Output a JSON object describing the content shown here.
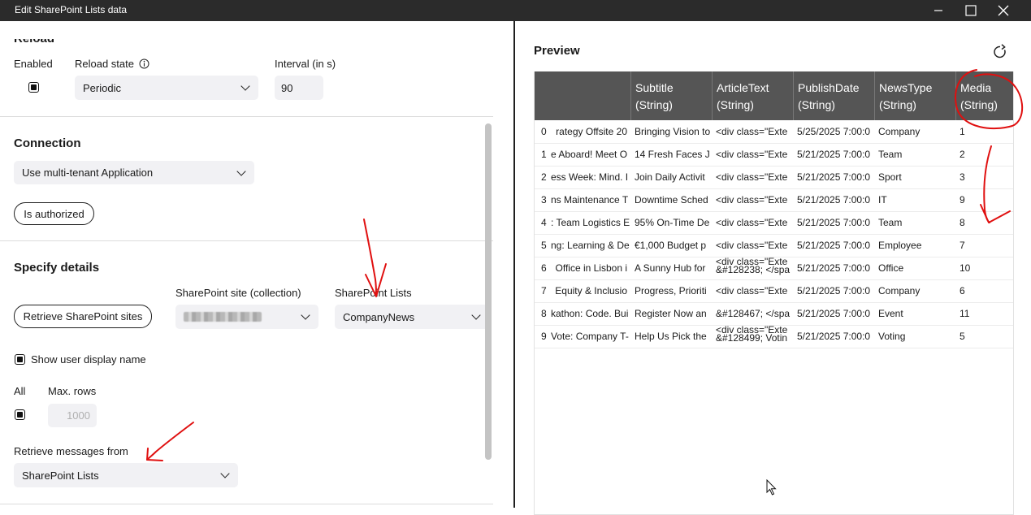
{
  "window": {
    "title": "Edit SharePoint Lists data",
    "minimize_icon": "minimize-icon",
    "maximize_icon": "maximize-icon",
    "close_icon": "close-icon"
  },
  "reload": {
    "section_title": "Reload",
    "enabled_label": "Enabled",
    "enabled_checked": true,
    "state_label": "Reload state",
    "state_info_icon": "info-icon",
    "state_value": "Periodic",
    "interval_label": "Interval (in s)",
    "interval_value": "90"
  },
  "connection": {
    "section_title": "Connection",
    "mode_value": "Use multi-tenant Application",
    "auth_button": "Is authorized"
  },
  "details": {
    "section_title": "Specify details",
    "retrieve_sites_button": "Retrieve SharePoint sites",
    "site_label": "SharePoint site (collection)",
    "site_value": "",
    "lists_label": "SharePoint Lists",
    "lists_value": "CompanyNews",
    "show_user_label": "Show user display name",
    "show_user_checked": true,
    "all_label": "All",
    "all_checked": true,
    "maxrows_label": "Max. rows",
    "maxrows_placeholder": "1000",
    "retrieve_from_label": "Retrieve messages from",
    "retrieve_from_value": "SharePoint Lists"
  },
  "preview": {
    "title": "Preview",
    "refresh_icon": "refresh-icon",
    "columns": [
      {
        "name": "",
        "type": ""
      },
      {
        "name": "Subtitle",
        "type": "(String)"
      },
      {
        "name": "ArticleText",
        "type": "(String)"
      },
      {
        "name": "PublishDate",
        "type": "(String)"
      },
      {
        "name": "NewsType",
        "type": "(String)"
      },
      {
        "name": "Media",
        "type": "(String)"
      }
    ],
    "rows": [
      {
        "idx": "0",
        "title": "rategy Offsite 20",
        "subtitle": "Bringing Vision to",
        "article": "<div class=\"Exte",
        "article2": "",
        "date": "5/25/2025 7:00:0",
        "type": "Company",
        "media": "1"
      },
      {
        "idx": "1",
        "title": "e Aboard! Meet O",
        "subtitle": "14 Fresh Faces J",
        "article": "<div class=\"Exte",
        "article2": "",
        "date": "5/21/2025 7:00:0",
        "type": "Team",
        "media": "2"
      },
      {
        "idx": "2",
        "title": "ess Week: Mind. I",
        "subtitle": "Join Daily Activit",
        "article": "<div class=\"Exte",
        "article2": "",
        "date": "5/21/2025 7:00:0",
        "type": "Sport",
        "media": "3"
      },
      {
        "idx": "3",
        "title": "ns Maintenance T",
        "subtitle": "Downtime Sched",
        "article": "<div class=\"Exte",
        "article2": "",
        "date": "5/21/2025 7:00:0",
        "type": "IT",
        "media": "9"
      },
      {
        "idx": "4",
        "title": ": Team Logistics E",
        "subtitle": "95% On-Time De",
        "article": "<div class=\"Exte",
        "article2": "",
        "date": "5/21/2025 7:00:0",
        "type": "Team",
        "media": "8"
      },
      {
        "idx": "5",
        "title": "ng: Learning & De",
        "subtitle": "€1,000 Budget p",
        "article": "<div class=\"Exte",
        "article2": "",
        "date": "5/21/2025 7:00:0",
        "type": "Employee",
        "media": "7"
      },
      {
        "idx": "6",
        "title": "Office in Lisbon i",
        "subtitle": "A Sunny Hub for",
        "article": "<div class=\"Exte",
        "article2": "&#128238; </spa",
        "date": "5/21/2025 7:00:0",
        "type": "Office",
        "media": "10"
      },
      {
        "idx": "7",
        "title": "Equity & Inclusio",
        "subtitle": "Progress, Prioriti",
        "article": "<div class=\"Exte",
        "article2": "",
        "date": "5/21/2025 7:00:0",
        "type": "Company",
        "media": "6"
      },
      {
        "idx": "8",
        "title": "kathon: Code. Bui",
        "subtitle": "Register Now an",
        "article": "&#128467; </spa",
        "article2": "",
        "date": "5/21/2025 7:00:0",
        "type": "Event",
        "media": "11"
      },
      {
        "idx": "9",
        "title": "Vote: Company T-",
        "subtitle": "Help Us Pick the",
        "article": "<div class=\"Exte",
        "article2": "&#128499; Votin",
        "date": "5/21/2025 7:00:0",
        "type": "Voting",
        "media": "5"
      }
    ]
  }
}
